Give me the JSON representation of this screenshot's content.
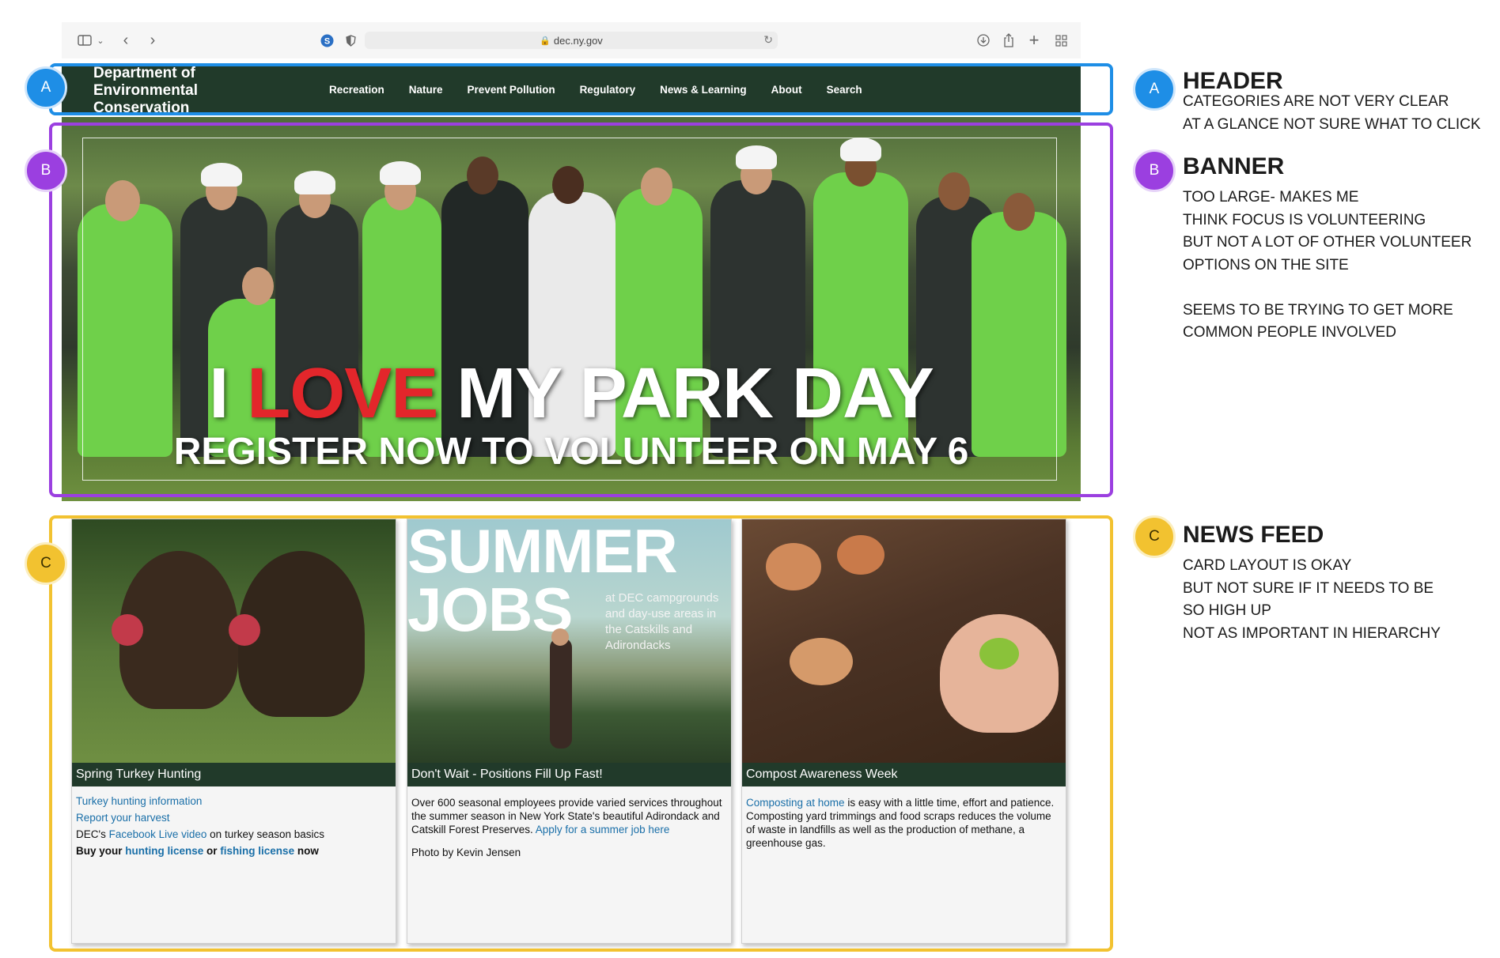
{
  "browser": {
    "url": "dec.ny.gov",
    "icons": [
      "sidebar-icon",
      "chevron-down-icon",
      "back-icon",
      "forward-icon",
      "extension-icon",
      "shield-icon",
      "reload-icon",
      "download-icon",
      "share-icon",
      "new-tab-icon",
      "tab-overview-icon"
    ]
  },
  "header": {
    "logo": "Department of Environmental Conservation",
    "nav": [
      "Recreation",
      "Nature",
      "Prevent Pollution",
      "Regulatory",
      "News & Learning",
      "About",
      "Search"
    ]
  },
  "banner": {
    "title_part1": "I ",
    "title_love": "LOVE",
    "title_part2": " MY PARK DAY",
    "subtitle": "REGISTER NOW TO VOLUNTEER ON MAY 6"
  },
  "cards": [
    {
      "caption": "Spring Turkey Hunting",
      "link1": "Turkey hunting information",
      "link2": "Report your harvest",
      "line3_pre": "DEC's ",
      "line3_link": "Facebook Live video",
      "line3_post": " on turkey season basics",
      "line4_pre": "Buy your ",
      "line4_link1": "hunting license",
      "line4_mid": " or ",
      "line4_link2": "fishing license",
      "line4_post": " now"
    },
    {
      "image_title1": "SUMMER",
      "image_title2": "JOBS",
      "image_sub": "at DEC campgrounds and day-use areas in the Catskills and Adirondacks",
      "caption": "Don't Wait - Positions Fill Up Fast!",
      "body": "Over 600 seasonal employees provide varied services throughout the summer season in New York State's beautiful Adirondack and Catskill Forest Preserves. ",
      "body_link": "Apply for a summer job here",
      "credit": "Photo by Kevin Jensen"
    },
    {
      "caption": "Compost Awareness Week",
      "body_link": "Composting at home",
      "body": " is easy with a little time, effort and patience. Composting yard trimmings and food scraps reduces the volume of waste in landfills as well as the production of methane, a greenhouse gas."
    }
  ],
  "annotations": [
    {
      "badge": "A",
      "title": "HEADER",
      "text": "CATEGORIES ARE NOT VERY CLEAR\nAT A GLANCE NOT SURE WHAT TO CLICK",
      "color": "#1e8ee6"
    },
    {
      "badge": "B",
      "title": "BANNER",
      "text": "TOO LARGE- MAKES ME\nTHINK FOCUS IS VOLUNTEERING\nBUT NOT A LOT OF OTHER VOLUNTEER\nOPTIONS ON THE SITE\n\nSEEMS TO BE TRYING TO GET MORE\nCOMMON PEOPLE INVOLVED",
      "color": "#9b3fe0"
    },
    {
      "badge": "C",
      "title": "NEWS FEED",
      "text": "CARD LAYOUT IS OKAY\nBUT NOT SURE IF IT NEEDS TO BE\nSO HIGH UP\nNOT AS IMPORTANT IN HIERARCHY",
      "color": "#f2c230"
    }
  ]
}
